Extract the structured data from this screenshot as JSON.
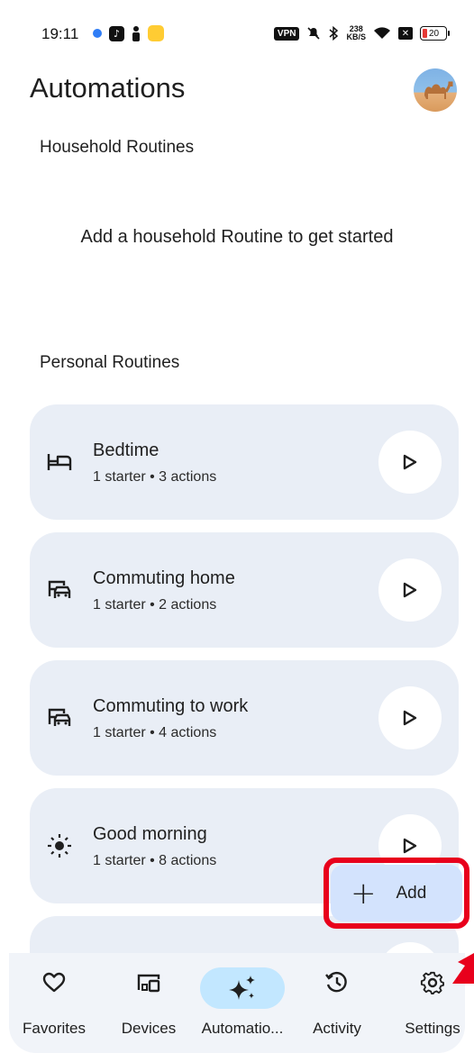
{
  "status_bar": {
    "time": "19:11",
    "vpn": "VPN",
    "speed_value": "238",
    "speed_unit": "KB/S",
    "battery": "20"
  },
  "header": {
    "title": "Automations"
  },
  "household": {
    "label": "Household Routines",
    "empty_message": "Add a household Routine to get started"
  },
  "personal": {
    "label": "Personal Routines",
    "routines": [
      {
        "name": "Bedtime",
        "summary": "1 starter • 3 actions",
        "icon": "bed-icon"
      },
      {
        "name": "Commuting home",
        "summary": "1 starter • 2 actions",
        "icon": "commute-icon"
      },
      {
        "name": "Commuting to work",
        "summary": "1 starter • 4 actions",
        "icon": "commute-icon"
      },
      {
        "name": "Good morning",
        "summary": "1 starter • 8 actions",
        "icon": "sun-icon"
      }
    ]
  },
  "fab": {
    "label": "Add"
  },
  "nav": {
    "items": [
      {
        "label": "Favorites",
        "icon": "heart-icon"
      },
      {
        "label": "Devices",
        "icon": "devices-icon"
      },
      {
        "label": "Automatio...",
        "icon": "sparkle-icon",
        "active": true
      },
      {
        "label": "Activity",
        "icon": "history-icon"
      },
      {
        "label": "Settings",
        "icon": "gear-icon"
      }
    ]
  },
  "colors": {
    "card_bg": "#e9eef6",
    "fab_bg": "#d3e3fd",
    "active_pill": "#c2e7ff",
    "highlight_red": "#e8001c"
  }
}
